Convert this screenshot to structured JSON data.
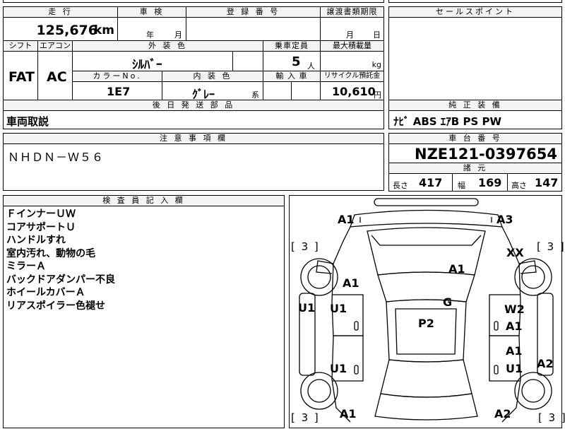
{
  "header": {
    "mileage_label": "走 行",
    "mileage_value": "125,676",
    "mileage_unit": "km",
    "inspection_label": "車 検",
    "inspection_year_unit": "年",
    "inspection_month_unit": "月",
    "registration_label": "登 録 番 号",
    "transfer_doc_label": "譲渡書類期限",
    "transfer_month_unit": "月",
    "transfer_day_unit": "日",
    "sales_point_label": "セールスポイント"
  },
  "specs": {
    "shift_label": "シフト",
    "shift_value": "FAT",
    "aircon_label": "エアコン",
    "aircon_value": "AC",
    "exterior_label": "外 装 色",
    "exterior_value": "ｼﾙﾊﾞｰ",
    "capacity_label": "乗車定員",
    "capacity_value": "5",
    "capacity_unit": "人",
    "max_load_label": "最大積載量",
    "max_load_unit": "kg",
    "color_no_label": "カラーNo.",
    "color_no_value": "1E7",
    "interior_label": "内 装 色",
    "interior_value": "ｸﾞﾚｰ",
    "interior_suffix": "系",
    "import_label": "輸 入 車",
    "recycle_label": "リサイクル預託金",
    "recycle_value": "10,610",
    "recycle_unit": "円"
  },
  "later_parts": {
    "label": "後 日 発 送 部 品",
    "value": "車両取説"
  },
  "genuine_equipment": {
    "label": "純 正 装 備",
    "value": "ﾅﾋﾞ ABS ｴｱB PS PW"
  },
  "caution": {
    "label": "注 意 事 項 欄",
    "value": "ＮＨＤＮ－Ｗ５６"
  },
  "chassis": {
    "label": "車 台 番 号",
    "value": "NZE121-0397654"
  },
  "dimensions": {
    "label": "諸 元",
    "length_label": "長さ",
    "length_value": "417",
    "width_label": "幅",
    "width_value": "169",
    "height_label": "高さ",
    "height_value": "147"
  },
  "inspector_notes": {
    "label": "検 査 員 記 入 欄",
    "lines": [
      "ＦインナーＵＷ",
      "コアサポートＵ",
      "ハンドルすれ",
      "室内汚れ、動物の毛",
      "ミラーＡ",
      "バックドアダンパー不良",
      "ホイールカバーＡ",
      "リアスポイラー色褪せ"
    ]
  },
  "diagram": {
    "marks": {
      "front_left_corner": "A1",
      "front_right_corner": "A3",
      "hood": "A1",
      "front_left_fender": "A1",
      "front_right_fender": "XX",
      "roof": "G",
      "roof_center": "P2",
      "left_front_door": "U1",
      "left_rear_door": "U1",
      "left_sill": "U1",
      "right_front_door_1": "W2",
      "right_front_door_2": "A1",
      "right_rear_door_1": "A1",
      "right_rear_door_2": "U1",
      "right_sill": "A2",
      "rear_left_corner": "A1",
      "rear_right_corner": "A2"
    },
    "tyre_front_left": "[ 3 ]",
    "tyre_front_right": "[ 3 ]",
    "tyre_rear_left": "[ 3 ]",
    "tyre_rear_right": "[ 3 ]"
  }
}
